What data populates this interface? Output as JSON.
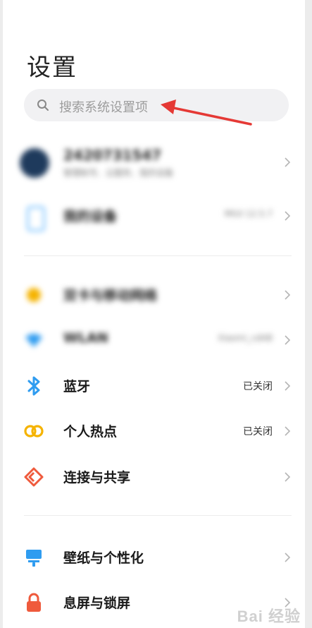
{
  "header": {
    "title": "设置"
  },
  "search": {
    "placeholder": "搜索系统设置项",
    "icon": "search-icon"
  },
  "account": {
    "name": "2420731547",
    "subtitle": "管理帐号、云服务、我的设备"
  },
  "device": {
    "label": "我的设备",
    "value": "MIUI 12.5.7"
  },
  "network_items": [
    {
      "label": "双卡与移动网络",
      "status": "",
      "icon": "sim-card-icon",
      "color": "#f5b300"
    },
    {
      "label": "WLAN",
      "status": "Xiaomi_cdAB",
      "icon": "wifi-icon",
      "color": "#2f9cf0"
    },
    {
      "label": "蓝牙",
      "status": "已关闭",
      "icon": "bluetooth-icon",
      "color": "#2f9cf0"
    },
    {
      "label": "个人热点",
      "status": "已关闭",
      "icon": "hotspot-icon",
      "color": "#f5b300"
    },
    {
      "label": "连接与共享",
      "status": "",
      "icon": "connection-share-icon",
      "color": "#ef5a3c"
    }
  ],
  "display_items": [
    {
      "label": "壁纸与个性化",
      "status": "",
      "icon": "wallpaper-icon",
      "color": "#2f9cf0"
    },
    {
      "label": "息屏与锁屏",
      "status": "",
      "icon": "lock-icon",
      "color": "#ef5a3c"
    }
  ],
  "watermark": "Bai 经验"
}
